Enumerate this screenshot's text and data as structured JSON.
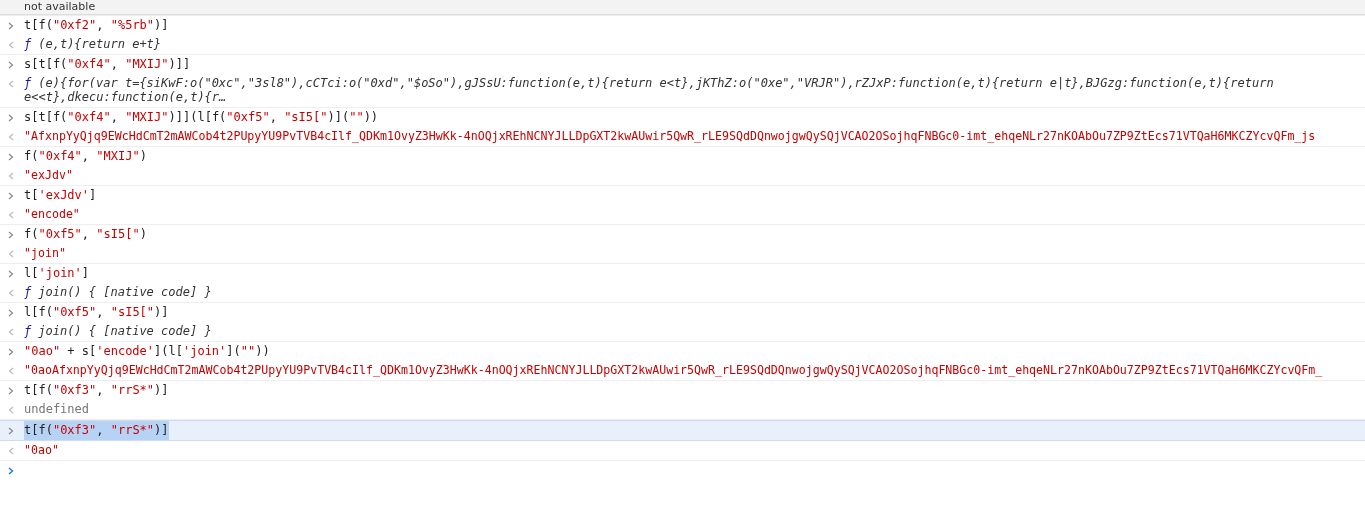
{
  "top_message": "not available",
  "entries": [
    {
      "selected": false,
      "input": [
        {
          "kind": "code",
          "text": "t[f("
        },
        {
          "kind": "string",
          "text": "\"0xf2\""
        },
        {
          "kind": "code",
          "text": ", "
        },
        {
          "kind": "string",
          "text": "\"%5rb\""
        },
        {
          "kind": "code",
          "text": ")]"
        }
      ],
      "output": {
        "kind": "function",
        "prefix": "ƒ",
        "lines": [
          "(e,t){return e+t}"
        ]
      }
    },
    {
      "selected": false,
      "input": [
        {
          "kind": "code",
          "text": "s[t[f("
        },
        {
          "kind": "string",
          "text": "\"0xf4\""
        },
        {
          "kind": "code",
          "text": ", "
        },
        {
          "kind": "string",
          "text": "\"MXIJ\""
        },
        {
          "kind": "code",
          "text": ")]]"
        }
      ],
      "output": {
        "kind": "function",
        "prefix": "ƒ",
        "lines": [
          "(e){for(var t={siKwF:o(\"0xc\",\"3sl8\"),cCTci:o(\"0xd\",\"$oSo\"),gJSsU:function(e,t){return e<t},jKThZ:o(\"0xe\",\"VRJR\"),rZJxP:function(e,t){return e|t},BJGzg:function(e,t){return",
          "e<<t},dkecu:function(e,t){r…"
        ]
      }
    },
    {
      "selected": false,
      "input": [
        {
          "kind": "code",
          "text": "s[t[f("
        },
        {
          "kind": "string",
          "text": "\"0xf4\""
        },
        {
          "kind": "code",
          "text": ", "
        },
        {
          "kind": "string",
          "text": "\"MXIJ\""
        },
        {
          "kind": "code",
          "text": ")]](l[f("
        },
        {
          "kind": "string",
          "text": "\"0xf5\""
        },
        {
          "kind": "code",
          "text": ", "
        },
        {
          "kind": "string",
          "text": "\"sI5[\""
        },
        {
          "kind": "code",
          "text": ")]("
        },
        {
          "kind": "string",
          "text": "\"\""
        },
        {
          "kind": "code",
          "text": "))"
        }
      ],
      "output": {
        "kind": "string",
        "text": "\"AfxnpYyQjq9EWcHdCmT2mAWCob4t2PUpyYU9PvTVB4cIlf_QDKm1OvyZ3HwKk-4nOQjxREhNCNYJLLDpGXT2kwAUwir5QwR_rLE9SQdDQnwojgwQySQjVCAO2OSojhqFNBGc0-imt_ehqeNLr27nKOAbOu7ZP9ZtEcs71VTQaH6MKCZYcvQFm_js"
      }
    },
    {
      "selected": false,
      "input": [
        {
          "kind": "code",
          "text": "f("
        },
        {
          "kind": "string",
          "text": "\"0xf4\""
        },
        {
          "kind": "code",
          "text": ", "
        },
        {
          "kind": "string",
          "text": "\"MXIJ\""
        },
        {
          "kind": "code",
          "text": ")"
        }
      ],
      "output": {
        "kind": "string",
        "text": "\"exJdv\""
      }
    },
    {
      "selected": false,
      "input": [
        {
          "kind": "code",
          "text": "t["
        },
        {
          "kind": "string",
          "text": "'exJdv'"
        },
        {
          "kind": "code",
          "text": "]"
        }
      ],
      "output": {
        "kind": "string",
        "text": "\"encode\""
      }
    },
    {
      "selected": false,
      "input": [
        {
          "kind": "code",
          "text": "f("
        },
        {
          "kind": "string",
          "text": "\"0xf5\""
        },
        {
          "kind": "code",
          "text": ", "
        },
        {
          "kind": "string",
          "text": "\"sI5[\""
        },
        {
          "kind": "code",
          "text": ")"
        }
      ],
      "output": {
        "kind": "string",
        "text": "\"join\""
      }
    },
    {
      "selected": false,
      "input": [
        {
          "kind": "code",
          "text": "l["
        },
        {
          "kind": "string",
          "text": "'join'"
        },
        {
          "kind": "code",
          "text": "]"
        }
      ],
      "output": {
        "kind": "function",
        "prefix": "ƒ",
        "lines": [
          "join() { [native code] }"
        ]
      }
    },
    {
      "selected": false,
      "input": [
        {
          "kind": "code",
          "text": "l[f("
        },
        {
          "kind": "string",
          "text": "\"0xf5\""
        },
        {
          "kind": "code",
          "text": ", "
        },
        {
          "kind": "string",
          "text": "\"sI5[\""
        },
        {
          "kind": "code",
          "text": ")]"
        }
      ],
      "output": {
        "kind": "function",
        "prefix": "ƒ",
        "lines": [
          "join() { [native code] }"
        ]
      }
    },
    {
      "selected": false,
      "input": [
        {
          "kind": "string",
          "text": "\"0ao\""
        },
        {
          "kind": "code",
          "text": " + s["
        },
        {
          "kind": "string",
          "text": "'encode'"
        },
        {
          "kind": "code",
          "text": "](l["
        },
        {
          "kind": "string",
          "text": "'join'"
        },
        {
          "kind": "code",
          "text": "]("
        },
        {
          "kind": "string",
          "text": "\"\""
        },
        {
          "kind": "code",
          "text": "))"
        }
      ],
      "output": {
        "kind": "string",
        "text": "\"0aoAfxnpYyQjq9EWcHdCmT2mAWCob4t2PUpyYU9PvTVB4cIlf_QDKm1OvyZ3HwKk-4nOQjxREhNCNYJLLDpGXT2kwAUwir5QwR_rLE9SQdDQnwojgwQySQjVCAO2OSojhqFNBGc0-imt_ehqeNLr27nKOAbOu7ZP9ZtEcs71VTQaH6MKCZYcvQFm_"
      }
    },
    {
      "selected": false,
      "input": [
        {
          "kind": "code",
          "text": "t[f("
        },
        {
          "kind": "string",
          "text": "\"0xf3\""
        },
        {
          "kind": "code",
          "text": ", "
        },
        {
          "kind": "string",
          "text": "\"rrS*\""
        },
        {
          "kind": "code",
          "text": ")]"
        }
      ],
      "output": {
        "kind": "undefined",
        "text": "undefined"
      }
    },
    {
      "selected": true,
      "input": [
        {
          "kind": "code",
          "text": "t[f("
        },
        {
          "kind": "string",
          "text": "\"0xf3\""
        },
        {
          "kind": "code",
          "text": ", "
        },
        {
          "kind": "string",
          "text": "\"rrS*\""
        },
        {
          "kind": "code",
          "text": ")]"
        }
      ],
      "output": {
        "kind": "string",
        "text": "\"0ao\""
      }
    }
  ]
}
